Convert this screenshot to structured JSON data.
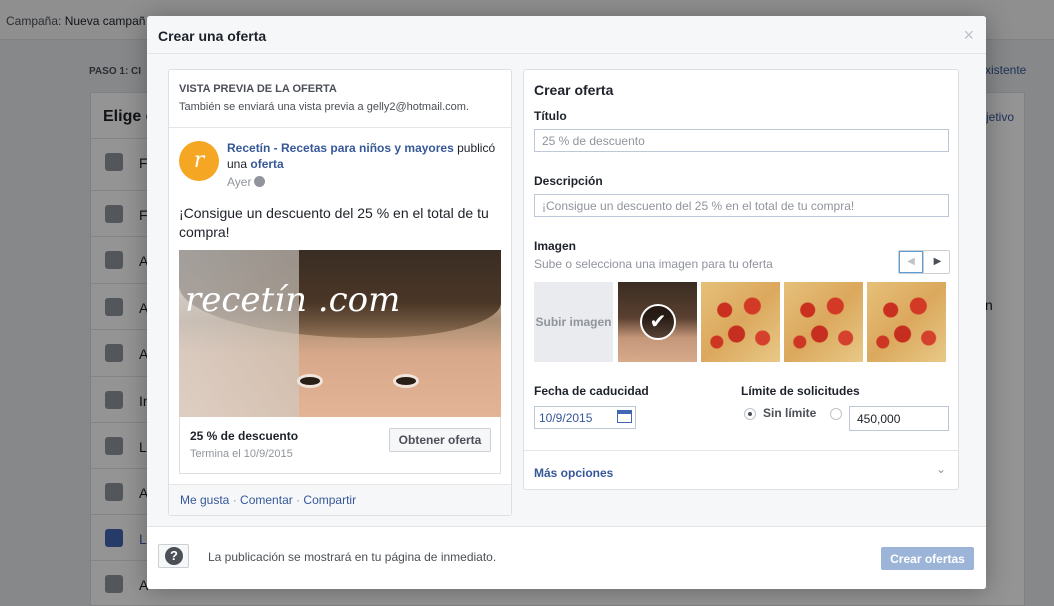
{
  "background": {
    "campaign_label": "Campaña:",
    "campaign_name": "Nueva campañ",
    "step_label": "PASO 1: CI",
    "right_link": "xistente",
    "card_title": "Elige e",
    "card_right_link": "jetivo",
    "list_items": [
      "F",
      "F",
      "A",
      "A",
      "A",
      "In",
      "L",
      "A",
      "L",
      "A"
    ],
    "right_fragment": "n"
  },
  "modal": {
    "title": "Crear una oferta",
    "close_glyph": "×"
  },
  "preview": {
    "header_title": "VISTA PREVIA DE LA OFERTA",
    "header_sub": "También se enviará una vista previa a gelly2@hotmail.com.",
    "avatar_letter": "r",
    "page_name": "Recetín - Recetas para niños y mayores",
    "published_text": "publicó una",
    "offer_link": "oferta",
    "time": "Ayer",
    "post_text": "¡Consigue un descuento del 25 % en el total de tu compra!",
    "image_logo_text": "recetín .com",
    "offer_title": "25 % de descuento",
    "offer_ends": "Termina el 10/9/2015",
    "get_offer_button": "Obtener oferta",
    "actions": {
      "like": "Me gusta",
      "comment": "Comentar",
      "share": "Compartir",
      "separator": "·"
    }
  },
  "form": {
    "title": "Crear oferta",
    "title_label": "Título",
    "title_value": "25 % de descuento",
    "description_label": "Descripción",
    "description_value": "¡Consigue un descuento del 25 % en el total de tu compra!",
    "image_label": "Imagen",
    "image_sub": "Sube o selecciona una imagen para tu oferta",
    "upload_label": "Subir imagen",
    "prev_glyph": "◀",
    "next_glyph": "▶",
    "check_glyph": "✔",
    "expiry_label": "Fecha de caducidad",
    "expiry_value": "10/9/2015",
    "limit_label": "Límite de solicitudes",
    "no_limit_label": "Sin límite",
    "limit_value": "450,000",
    "more_options": "Más opciones",
    "chevron_glyph": "⌄"
  },
  "footer": {
    "help_glyph": "?",
    "note": "La publicación se mostrará en tu página de inmediato.",
    "create_button": "Crear ofertas"
  }
}
